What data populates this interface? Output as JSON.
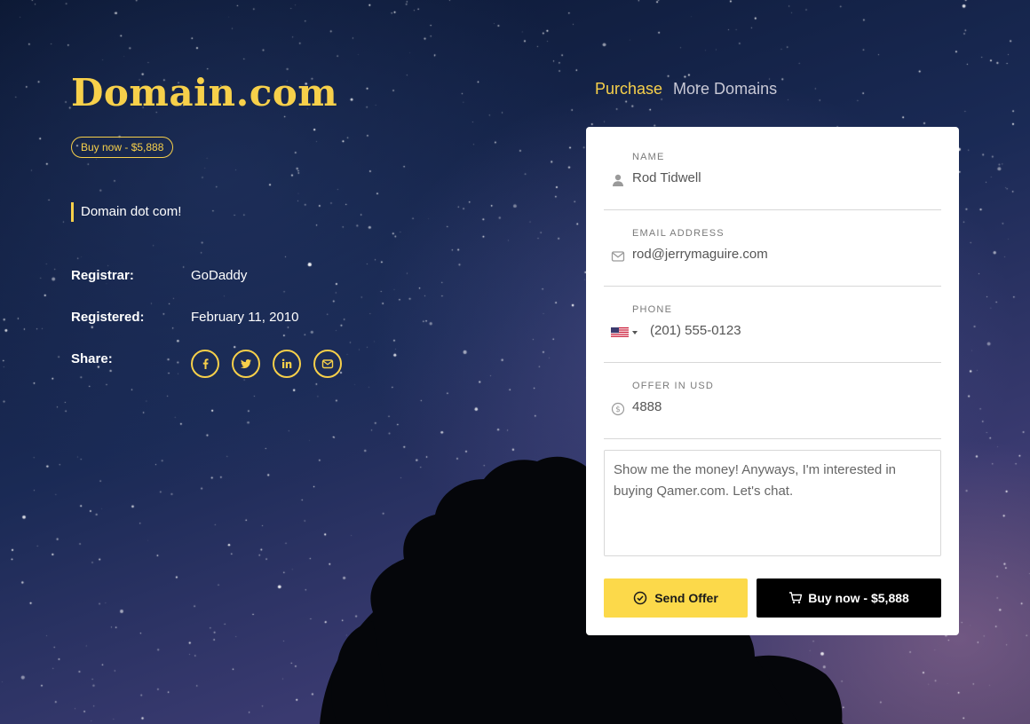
{
  "brand": {
    "title": "Domain.com",
    "buy_pill_label": "Buy now - $5,888"
  },
  "tagline": "Domain dot com!",
  "info": {
    "registrar_label": "Registrar:",
    "registrar_value": "GoDaddy",
    "registered_label": "Registered:",
    "registered_value": "February 11, 2010",
    "share_label": "Share:"
  },
  "share_icons": [
    "facebook-icon",
    "twitter-icon",
    "linkedin-icon",
    "email-icon"
  ],
  "nav": {
    "purchase": "Purchase",
    "more_domains": "More Domains"
  },
  "form": {
    "name_label": "NAME",
    "name_value": "Rod Tidwell",
    "email_label": "EMAIL ADDRESS",
    "email_value": "rod@jerrymaguire.com",
    "phone_label": "PHONE",
    "phone_value": "(201) 555-0123",
    "phone_country_flag": "us-flag",
    "offer_label": "OFFER IN USD",
    "offer_value": "4888",
    "message_value": "Show me the money! Anyways, I'm interested in buying Qamer.com. Let's chat.",
    "send_label": "Send Offer",
    "buy_label": "Buy now - $5,888"
  },
  "colors": {
    "accent": "#f7d04a",
    "send_button": "#fcd94a",
    "buy_button": "#000000",
    "card": "#ffffff"
  }
}
